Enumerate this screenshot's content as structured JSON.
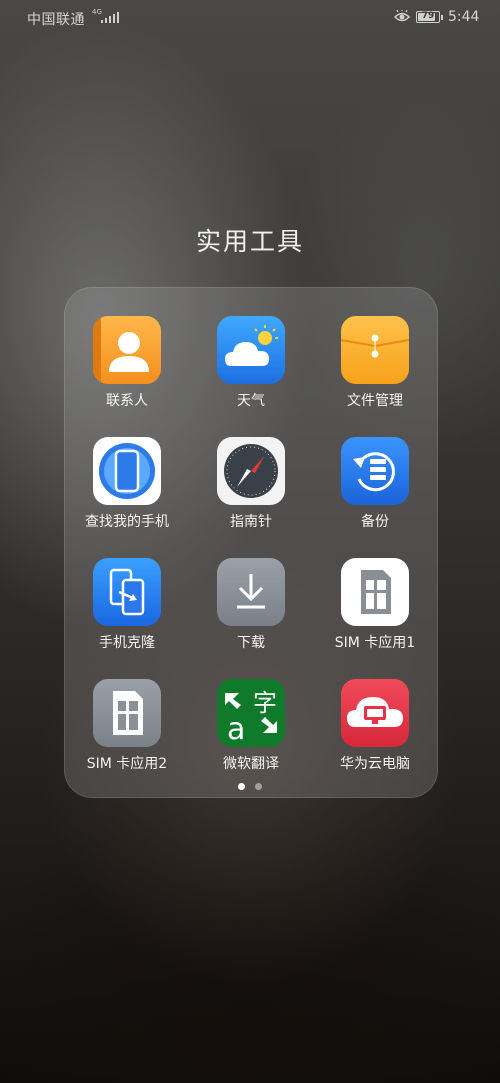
{
  "status_bar": {
    "carrier": "中国联通",
    "network_type": "4G",
    "battery": "79",
    "time": "5:44"
  },
  "folder": {
    "title": "实用工具",
    "apps": [
      {
        "label": "联系人",
        "icon": "contacts-icon"
      },
      {
        "label": "天气",
        "icon": "weather-icon"
      },
      {
        "label": "文件管理",
        "icon": "file-manager-icon"
      },
      {
        "label": "查找我的手机",
        "icon": "find-my-phone-icon"
      },
      {
        "label": "指南针",
        "icon": "compass-icon"
      },
      {
        "label": "备份",
        "icon": "backup-icon"
      },
      {
        "label": "手机克隆",
        "icon": "phone-clone-icon"
      },
      {
        "label": "下载",
        "icon": "download-icon"
      },
      {
        "label": "SIM 卡应用1",
        "icon": "sim-card-icon"
      },
      {
        "label": "SIM 卡应用2",
        "icon": "sim-card-icon"
      },
      {
        "label": "微软翻译",
        "icon": "microsoft-translator-icon"
      },
      {
        "label": "华为云电脑",
        "icon": "huawei-cloud-pc-icon"
      }
    ]
  },
  "pagination": {
    "total": 2,
    "active": 1
  }
}
